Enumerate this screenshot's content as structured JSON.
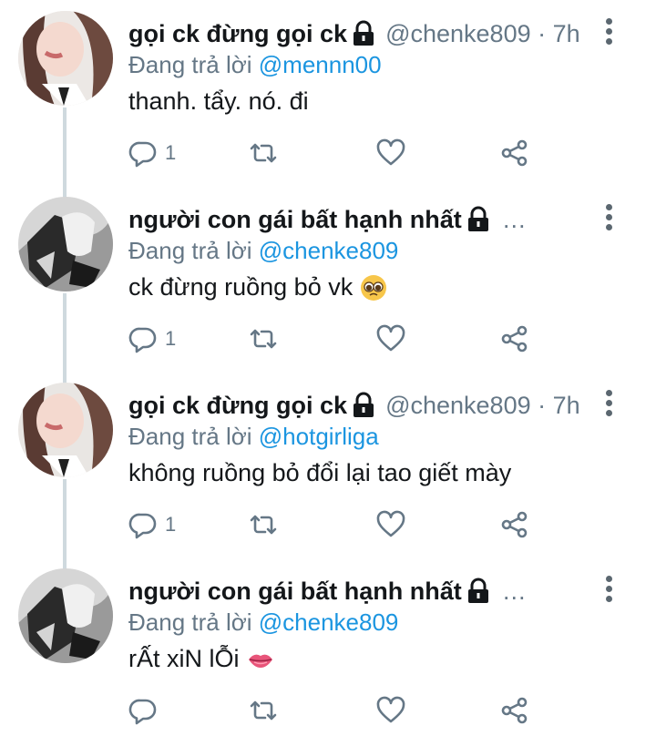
{
  "tweets": [
    {
      "author": "gọi ck đừng gọi ck",
      "handle": "@chenke809 · 7h",
      "handle_truncated": false,
      "reply_prefix": "Đang trả lời ",
      "reply_to": "@mennn00",
      "text": "thanh. tẩy. nó. đi",
      "emoji": "",
      "reply_count": "1",
      "avatar": "girl-avatar"
    },
    {
      "author": "người con gái bất hạnh nhất",
      "handle": "…",
      "handle_truncated": true,
      "reply_prefix": "Đang trả lời ",
      "reply_to": "@chenke809",
      "text": "ck đừng ruồng bỏ vk",
      "emoji": "pleading-face-emoji",
      "reply_count": "1",
      "avatar": "bw-avatar"
    },
    {
      "author": "gọi ck đừng gọi ck",
      "handle": "@chenke809 · 7h",
      "handle_truncated": false,
      "reply_prefix": "Đang trả lời ",
      "reply_to": "@hotgirliga",
      "text": "không ruồng bỏ đổi lại tao giết mày",
      "emoji": "",
      "reply_count": "1",
      "avatar": "girl-avatar"
    },
    {
      "author": "người con gái bất hạnh nhất",
      "handle": "…",
      "handle_truncated": true,
      "reply_prefix": "Đang trả lời ",
      "reply_to": "@chenke809",
      "text": "rẤt xiN lỖi",
      "emoji": "lips-emoji",
      "reply_count": "",
      "avatar": "bw-avatar"
    }
  ],
  "colors": {
    "accent": "#1b95e0",
    "secondary_text": "#657786",
    "thread_line": "#cfd9de",
    "icon": "#657786"
  },
  "icons": [
    "reply-icon",
    "retweet-icon",
    "like-icon",
    "share-icon",
    "lock-icon",
    "more-icon"
  ]
}
